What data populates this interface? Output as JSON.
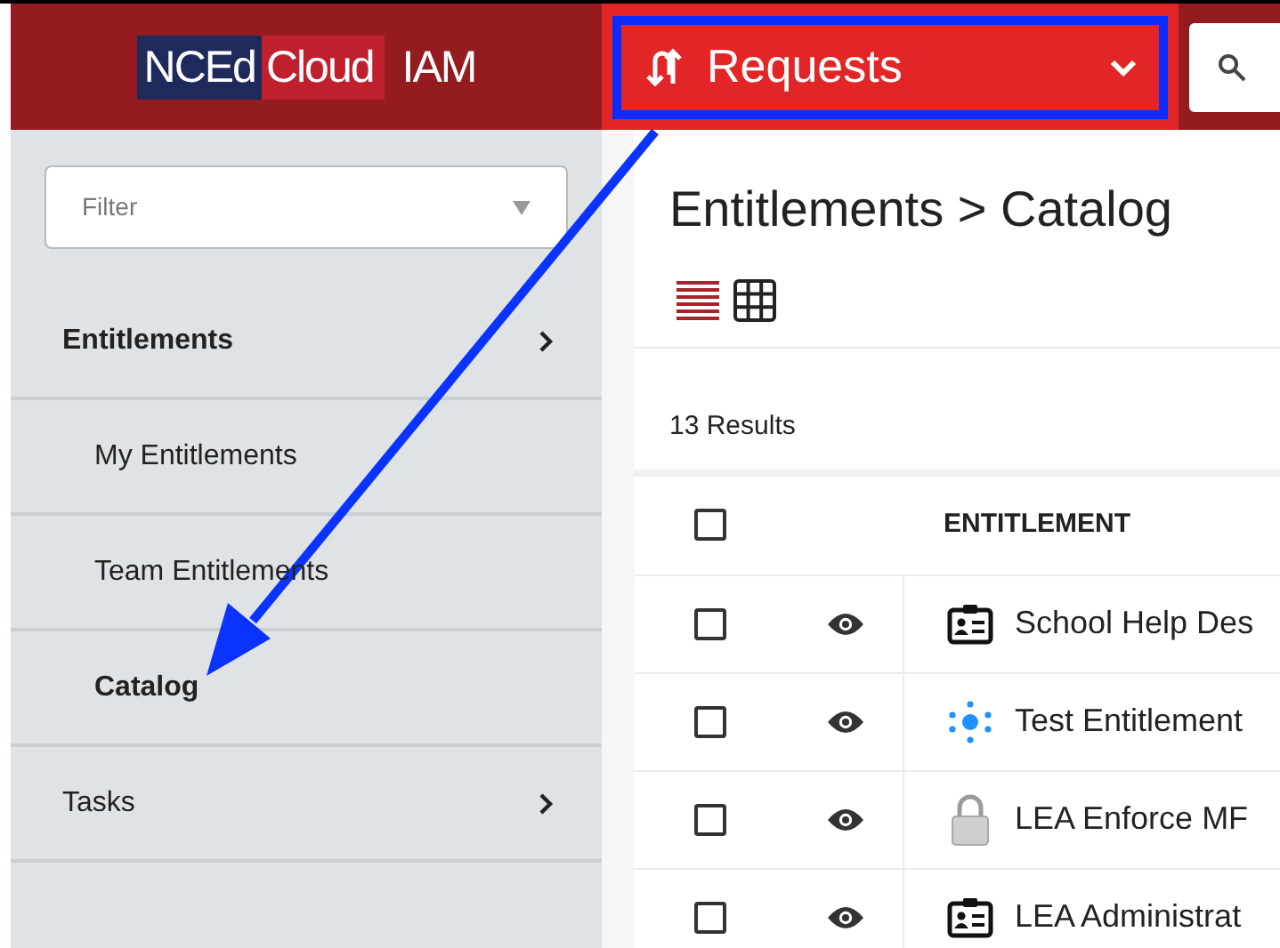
{
  "header": {
    "logo": {
      "part_1": "NCEd",
      "part_2": "Cloud",
      "part_3": "IAM"
    },
    "menu": {
      "label": "Requests"
    }
  },
  "sidebar": {
    "filter": {
      "placeholder": "Filter"
    },
    "items": [
      {
        "label": "Entitlements",
        "children": [
          {
            "label": "My Entitlements",
            "selected": false
          },
          {
            "label": "Team Entitlements",
            "selected": false
          },
          {
            "label": "Catalog",
            "selected": true
          }
        ]
      },
      {
        "label": "Tasks"
      }
    ]
  },
  "main": {
    "title": "Entitlements > Catalog",
    "views": [
      {
        "kind": "list",
        "selected": true
      },
      {
        "kind": "grid",
        "selected": false
      }
    ],
    "results": "13 Results",
    "table": {
      "select_all": {
        "checked": false
      },
      "columns": [
        "ENTITLEMENT"
      ],
      "rows": [
        {
          "checked": false,
          "kind": "id-card",
          "name": "School Help Des"
        },
        {
          "checked": false,
          "kind": "network",
          "name": "Test Entitlement"
        },
        {
          "checked": false,
          "kind": "lock",
          "name": "LEA Enforce MF"
        },
        {
          "checked": false,
          "kind": "id-card",
          "name": "LEA Administrat"
        }
      ]
    }
  }
}
